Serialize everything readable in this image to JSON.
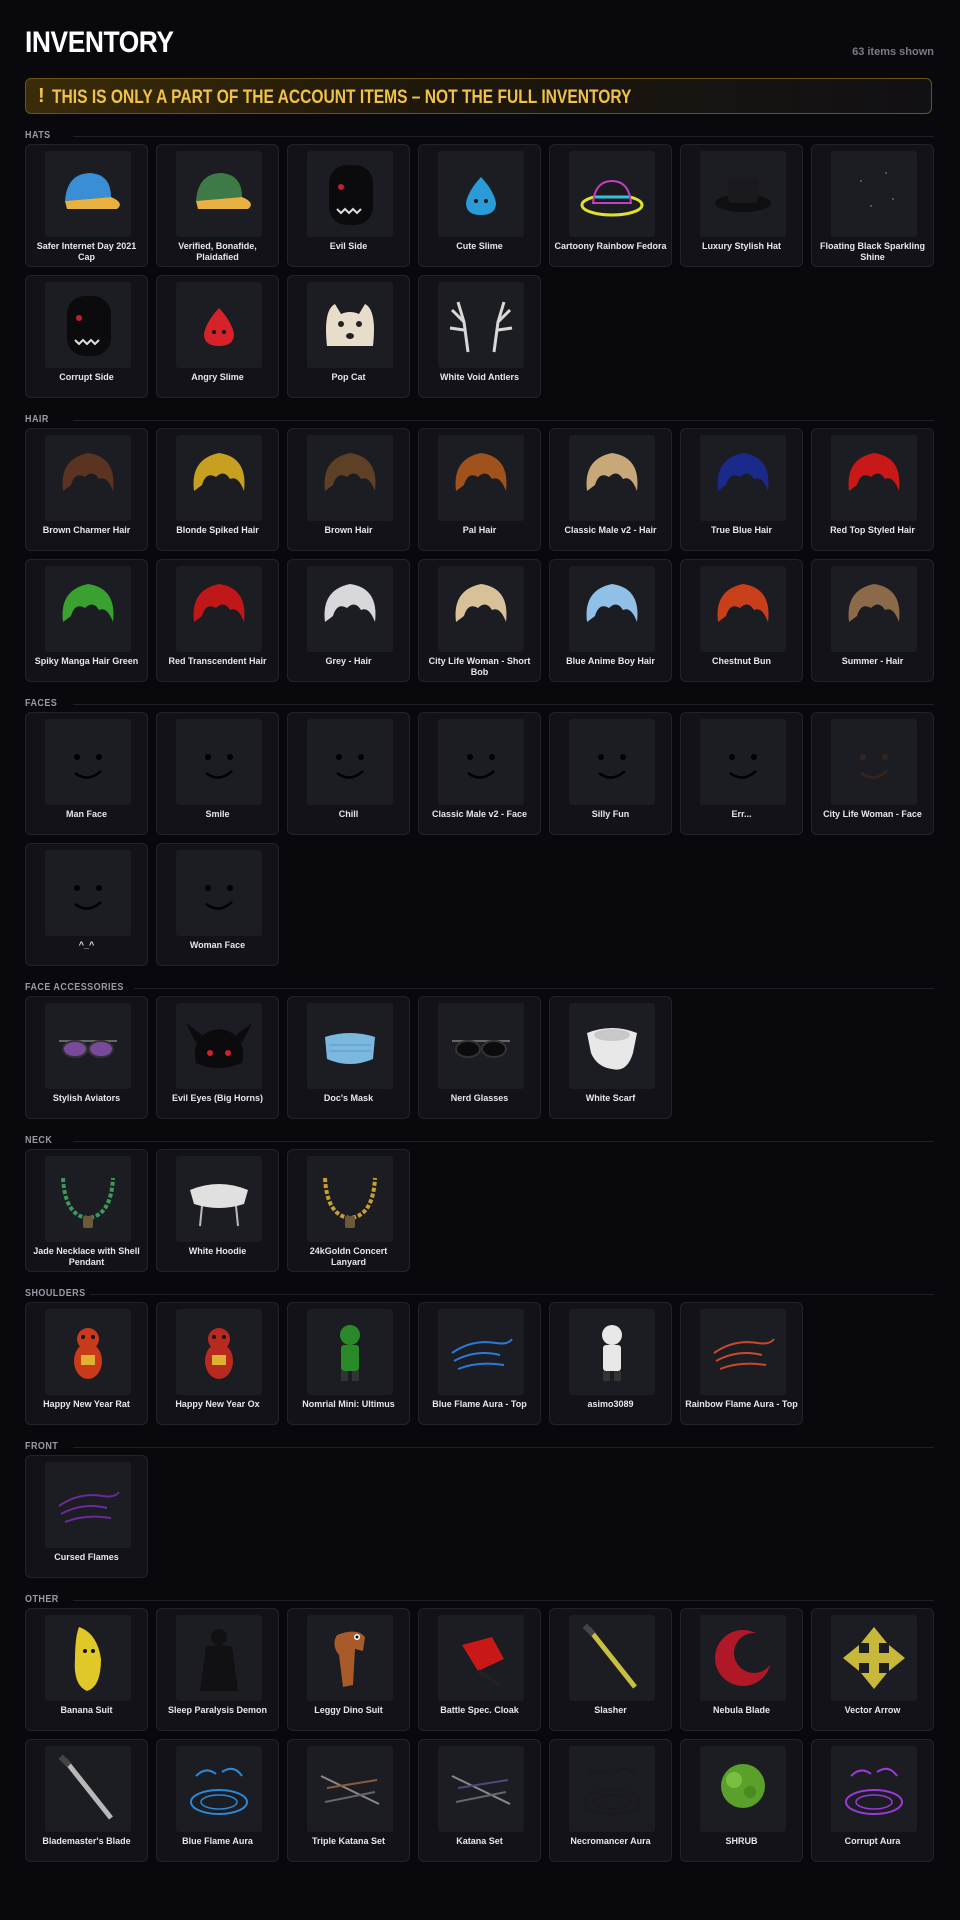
{
  "page": {
    "title": "INVENTORY",
    "count": "63 items shown",
    "warning_icon": "!",
    "warning": "THIS IS ONLY A PART OF THE ACCOUNT ITEMS – NOT THE FULL INVENTORY"
  },
  "colors": {
    "background": "#09090d",
    "card": "#121218",
    "thumb": "#1c1c23",
    "warning_text": "#f0c24a"
  },
  "sections": [
    {
      "label": "HATS",
      "items": [
        {
          "name": "Safer Internet Day 2021 Cap",
          "icon": "cap-icon",
          "color": "#3a8ed6"
        },
        {
          "name": "Verified, Bonafide, Plaidafied",
          "icon": "cap-icon",
          "color": "#3e7a48"
        },
        {
          "name": "Evil Side",
          "icon": "head-icon",
          "color": "#0b0b0d"
        },
        {
          "name": "Cute Slime",
          "icon": "slime-icon",
          "color": "#2a9bd6"
        },
        {
          "name": "Cartoony Rainbow Fedora",
          "icon": "fedora-icon",
          "color": "#1a1a1e"
        },
        {
          "name": "Luxury Stylish Hat",
          "icon": "hat-icon",
          "color": "#1a1a1e"
        },
        {
          "name": "Floating Black Sparkling Shine",
          "icon": "sparkle-icon",
          "color": "#2a2a30"
        },
        {
          "name": "Corrupt Side",
          "icon": "head-icon",
          "color": "#0b0b0d"
        },
        {
          "name": "Angry Slime",
          "icon": "slime-icon",
          "color": "#d62228"
        },
        {
          "name": "Pop Cat",
          "icon": "cat-icon",
          "color": "#e8dccb"
        },
        {
          "name": "White Void Antlers",
          "icon": "antlers-icon",
          "color": "#d8d8d8"
        }
      ]
    },
    {
      "label": "HAIR",
      "items": [
        {
          "name": "Brown Charmer Hair",
          "icon": "hair-icon",
          "color": "#5a3420"
        },
        {
          "name": "Blonde Spiked Hair",
          "icon": "hair-icon",
          "color": "#c8a020"
        },
        {
          "name": "Brown Hair",
          "icon": "hair-icon",
          "color": "#5e4026"
        },
        {
          "name": "Pal Hair",
          "icon": "hair-icon",
          "color": "#a0521c"
        },
        {
          "name": "Classic Male v2 - Hair",
          "icon": "hair-icon",
          "color": "#c8a878"
        },
        {
          "name": "True Blue Hair",
          "icon": "hair-icon",
          "color": "#1a2a8a"
        },
        {
          "name": "Red Top Styled Hair",
          "icon": "hair-icon",
          "color": "#c81818"
        },
        {
          "name": "Spiky Manga Hair Green",
          "icon": "hair-icon",
          "color": "#3aa030"
        },
        {
          "name": "Red Transcendent Hair",
          "icon": "hair-icon",
          "color": "#c01818"
        },
        {
          "name": "Grey - Hair",
          "icon": "hair-icon",
          "color": "#d8d8dc"
        },
        {
          "name": "City Life Woman - Short Bob",
          "icon": "hair-icon",
          "color": "#d8c098"
        },
        {
          "name": "Blue Anime Boy Hair",
          "icon": "hair-icon",
          "color": "#90c0e8"
        },
        {
          "name": "Chestnut Bun",
          "icon": "hair-icon",
          "color": "#c8401a"
        },
        {
          "name": "Summer - Hair",
          "icon": "hair-icon",
          "color": "#8a6a48"
        }
      ]
    },
    {
      "label": "FACES",
      "items": [
        {
          "name": "Man Face",
          "icon": "face-icon",
          "color": "#000000"
        },
        {
          "name": "Smile",
          "icon": "face-icon",
          "color": "#000000"
        },
        {
          "name": "Chill",
          "icon": "face-icon",
          "color": "#000000"
        },
        {
          "name": "Classic Male v2 - Face",
          "icon": "face-icon",
          "color": "#000000"
        },
        {
          "name": "Silly Fun",
          "icon": "face-icon",
          "color": "#000000"
        },
        {
          "name": "Err...",
          "icon": "face-icon",
          "color": "#000000"
        },
        {
          "name": "City Life Woman - Face",
          "icon": "face-icon",
          "color": "#3a2418"
        },
        {
          "name": "^_^",
          "icon": "face-icon",
          "color": "#000000"
        },
        {
          "name": "Woman Face",
          "icon": "face-icon",
          "color": "#000000"
        }
      ]
    },
    {
      "label": "FACE ACCESSORIES",
      "items": [
        {
          "name": "Stylish Aviators",
          "icon": "glasses-icon",
          "color": "#7a4a9a"
        },
        {
          "name": "Evil Eyes (Big Horns)",
          "icon": "horns-icon",
          "color": "#0b0b0d"
        },
        {
          "name": "Doc's Mask",
          "icon": "mask-icon",
          "color": "#7ab8e0"
        },
        {
          "name": "Nerd Glasses",
          "icon": "glasses-icon",
          "color": "#0b0b0d"
        },
        {
          "name": "White Scarf",
          "icon": "scarf-icon",
          "color": "#e8e8e8"
        }
      ]
    },
    {
      "label": "NECK",
      "items": [
        {
          "name": "Jade Necklace with Shell Pendant",
          "icon": "necklace-icon",
          "color": "#3a9a5a"
        },
        {
          "name": "White Hoodie",
          "icon": "hoodie-icon",
          "color": "#e0e0e0"
        },
        {
          "name": "24kGoldn Concert Lanyard",
          "icon": "necklace-icon",
          "color": "#c8a030"
        }
      ]
    },
    {
      "label": "SHOULDERS",
      "items": [
        {
          "name": "Happy New Year Rat",
          "icon": "pet-icon",
          "color": "#c83a1a"
        },
        {
          "name": "Happy New Year Ox",
          "icon": "pet-icon",
          "color": "#b82a20"
        },
        {
          "name": "Nomrial Mini: Ultimus",
          "icon": "figure-icon",
          "color": "#2a8a2a"
        },
        {
          "name": "Blue Flame Aura - Top",
          "icon": "flame-icon",
          "color": "#2a7ad8"
        },
        {
          "name": "asimo3089",
          "icon": "figure-icon",
          "color": "#e8e8e8"
        },
        {
          "name": "Rainbow Flame Aura - Top",
          "icon": "flame-icon",
          "color": "#c84a2a"
        }
      ]
    },
    {
      "label": "FRONT",
      "items": [
        {
          "name": "Cursed Flames",
          "icon": "flame-icon",
          "color": "#6a2a9a"
        }
      ]
    },
    {
      "label": "OTHER",
      "items": [
        {
          "name": "Banana Suit",
          "icon": "banana-icon",
          "color": "#e0c828"
        },
        {
          "name": "Sleep Paralysis Demon",
          "icon": "ghost-icon",
          "color": "#111114"
        },
        {
          "name": "Leggy Dino Suit",
          "icon": "dino-icon",
          "color": "#a85a2a"
        },
        {
          "name": "Battle Spec. Cloak",
          "icon": "cloak-icon",
          "color": "#c81818"
        },
        {
          "name": "Slasher",
          "icon": "sword-icon",
          "color": "#c8c040"
        },
        {
          "name": "Nebula Blade",
          "icon": "blade-icon",
          "color": "#b01828"
        },
        {
          "name": "Vector Arrow",
          "icon": "arrow-icon",
          "color": "#c8b83a"
        },
        {
          "name": "Blademaster's Blade",
          "icon": "sword-icon",
          "color": "#b8b8b8"
        },
        {
          "name": "Blue Flame Aura",
          "icon": "aura-icon",
          "color": "#2a8ad8"
        },
        {
          "name": "Triple Katana Set",
          "icon": "katana-icon",
          "color": "#8a5a3a"
        },
        {
          "name": "Katana Set",
          "icon": "katana-icon",
          "color": "#4a4a7a"
        },
        {
          "name": "Necromancer Aura",
          "icon": "aura-icon",
          "color": "#1a1a1a"
        },
        {
          "name": "SHRUB",
          "icon": "shrub-icon",
          "color": "#5aa02a"
        },
        {
          "name": "Corrupt Aura",
          "icon": "aura-icon",
          "color": "#9a3ad8"
        }
      ]
    }
  ]
}
